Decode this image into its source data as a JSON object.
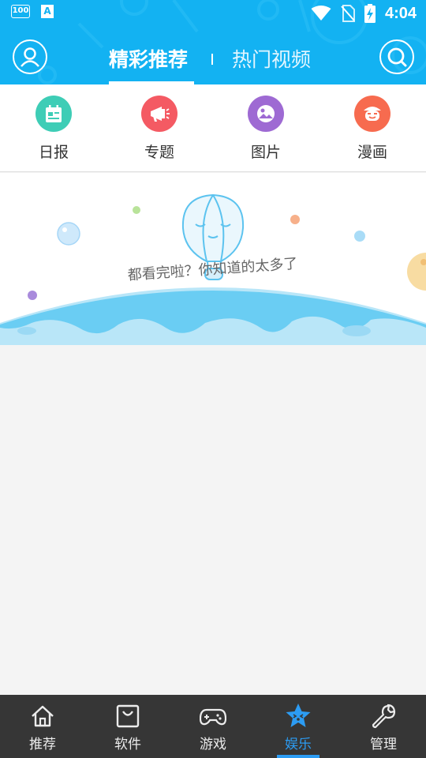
{
  "status_bar": {
    "battery_badge": "100",
    "a_icon": "A",
    "time": "4:04"
  },
  "header": {
    "tabs": [
      {
        "label": "精彩推荐"
      },
      {
        "label": "热门视频"
      }
    ],
    "separator": "I",
    "active_tab": 0
  },
  "categories": [
    {
      "label": "日报",
      "icon": "calendar-icon",
      "color": "#3ecdb6"
    },
    {
      "label": "专题",
      "icon": "megaphone-icon",
      "color": "#f45a63"
    },
    {
      "label": "图片",
      "icon": "image-icon",
      "color": "#9e6ad3"
    },
    {
      "label": "漫画",
      "icon": "comic-face-icon",
      "color": "#f76b4f"
    }
  ],
  "empty_state": {
    "message": "都看完啦？你知道的太多了"
  },
  "bottom_nav": {
    "items": [
      {
        "label": "推荐",
        "icon": "home-icon"
      },
      {
        "label": "软件",
        "icon": "bag-icon"
      },
      {
        "label": "游戏",
        "icon": "gamepad-icon"
      },
      {
        "label": "娱乐",
        "icon": "star-face-icon"
      },
      {
        "label": "管理",
        "icon": "wrench-icon"
      }
    ],
    "active_index": 3
  },
  "colors": {
    "brand_blue": "#13b2f2",
    "active_nav": "#2c9cf3",
    "bottom_nav_bg": "#363636"
  }
}
